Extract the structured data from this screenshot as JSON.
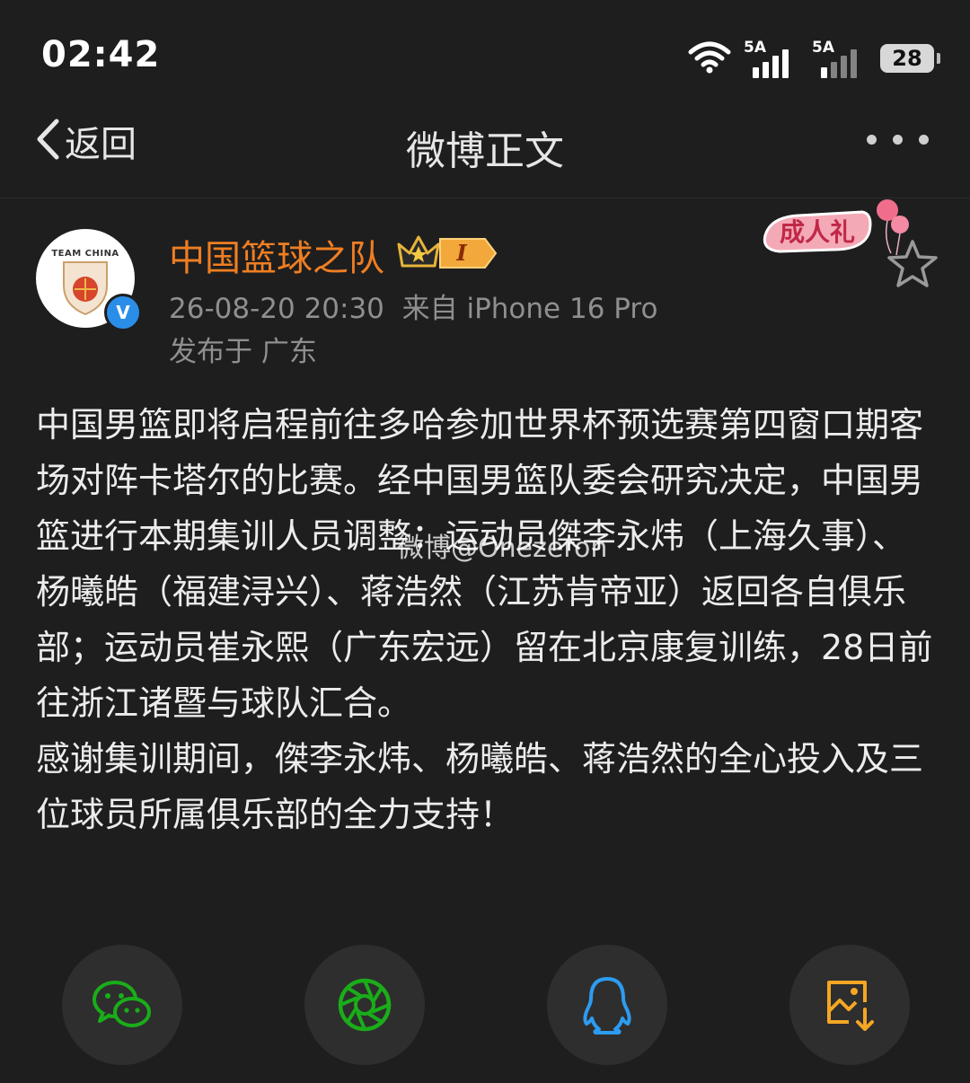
{
  "status_bar": {
    "time": "02:42",
    "signal1_label": "5A",
    "signal2_label": "5A",
    "battery": "28",
    "icons": [
      "wifi-icon",
      "signal-icon",
      "signal-icon",
      "battery-icon"
    ]
  },
  "nav": {
    "back_label": "返回",
    "title": "微博正文",
    "more_icon": "more-dots-icon"
  },
  "post": {
    "username": "中国篮球之队",
    "avatar_text": "TEAM CHINA",
    "timestamp": "26-08-20 20:30",
    "source": "来自 iPhone 16 Pro",
    "location": "发布于 广东",
    "badge_text": "成人礼",
    "level_label": "I",
    "paragraphs": [
      "中国男篮即将启程前往多哈参加世界杯预选赛第四窗口期客场对阵卡塔尔的比赛。经中国男篮队委会研究决定，中国男篮进行本期集训人员调整：运动员傑李永炜（上海久事）、杨曦皓（福建浔兴）、蒋浩然（江苏肯帝亚）返回各自俱乐部；运动员崔永熙（广东宏远）留在北京康复训练，28日前往浙江诸暨与球队汇合。",
      "感谢集训期间，傑李永炜、杨曦皓、蒋浩然的全心投入及三位球员所属俱乐部的全力支持！"
    ],
    "watermark": "微博@Onezeron"
  },
  "share": {
    "buttons": [
      {
        "icon": "wechat-icon",
        "color": "#1aad19"
      },
      {
        "icon": "moments-icon",
        "color": "#1aad19"
      },
      {
        "icon": "qq-icon",
        "color": "#2d9cf0"
      },
      {
        "icon": "save-image-icon",
        "color": "#f5a623"
      }
    ]
  }
}
